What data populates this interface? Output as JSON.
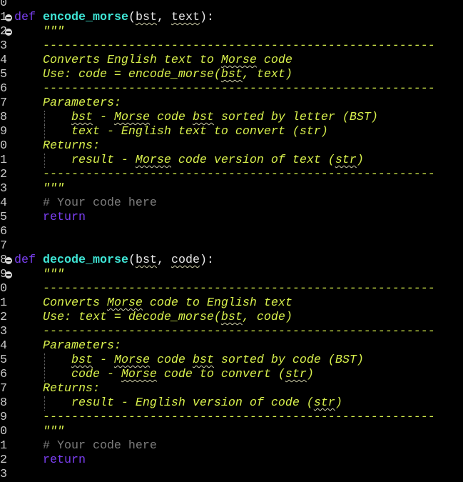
{
  "colors": {
    "keyword": "#7b3ff2",
    "function": "#3fe6d6",
    "docstring": "#d8f04c",
    "comment": "#7c7c7c",
    "background": "#000000"
  },
  "lines": [
    {
      "n": "0",
      "tokens": []
    },
    {
      "n": "1",
      "fold": true,
      "tokens": [
        {
          "t": "def",
          "c": "kw"
        },
        {
          "t": " ",
          "c": "p"
        },
        {
          "t": "encode_morse",
          "c": "fn"
        },
        {
          "t": "(",
          "c": "p"
        },
        {
          "t": "bst",
          "c": "p",
          "u": true
        },
        {
          "t": ", ",
          "c": "p"
        },
        {
          "t": "text",
          "c": "p",
          "u": true
        },
        {
          "t": "):",
          "c": "p"
        }
      ]
    },
    {
      "n": "2",
      "fold": true,
      "tokens": [
        {
          "t": "    \"\"\"",
          "c": "doc"
        }
      ]
    },
    {
      "n": "3",
      "tokens": [
        {
          "t": "    -------------------------------------------------------",
          "c": "doc"
        }
      ]
    },
    {
      "n": "4",
      "tokens": [
        {
          "t": "    Converts English text to ",
          "c": "doc"
        },
        {
          "t": "Morse",
          "c": "doc",
          "u": true
        },
        {
          "t": " code",
          "c": "doc"
        }
      ]
    },
    {
      "n": "5",
      "tokens": [
        {
          "t": "    Use: code = encode_morse(",
          "c": "doc"
        },
        {
          "t": "bst",
          "c": "doc",
          "u": true
        },
        {
          "t": ", text)",
          "c": "doc"
        }
      ]
    },
    {
      "n": "6",
      "tokens": [
        {
          "t": "    -------------------------------------------------------",
          "c": "doc"
        }
      ]
    },
    {
      "n": "7",
      "tokens": [
        {
          "t": "    Parameters:",
          "c": "doc"
        }
      ]
    },
    {
      "n": "8",
      "guide": true,
      "tokens": [
        {
          "t": "        ",
          "c": "doc"
        },
        {
          "t": "bst",
          "c": "doc",
          "u": true
        },
        {
          "t": " - ",
          "c": "doc"
        },
        {
          "t": "Morse",
          "c": "doc",
          "u": true
        },
        {
          "t": " code ",
          "c": "doc"
        },
        {
          "t": "bst",
          "c": "doc",
          "u": true
        },
        {
          "t": " sorted by letter (BST)",
          "c": "doc"
        }
      ]
    },
    {
      "n": "9",
      "guide": true,
      "tokens": [
        {
          "t": "        text - English text to convert (str)",
          "c": "doc"
        }
      ]
    },
    {
      "n": "0",
      "tokens": [
        {
          "t": "    Returns:",
          "c": "doc"
        }
      ]
    },
    {
      "n": "1",
      "guide": true,
      "tokens": [
        {
          "t": "        result - ",
          "c": "doc"
        },
        {
          "t": "Morse",
          "c": "doc",
          "u": true
        },
        {
          "t": " code version of text (",
          "c": "doc"
        },
        {
          "t": "str",
          "c": "doc",
          "u": true
        },
        {
          "t": ")",
          "c": "doc"
        }
      ]
    },
    {
      "n": "2",
      "tokens": [
        {
          "t": "    -------------------------------------------------------",
          "c": "doc"
        }
      ]
    },
    {
      "n": "3",
      "tokens": [
        {
          "t": "    \"\"\"",
          "c": "doc"
        }
      ]
    },
    {
      "n": "4",
      "tokens": [
        {
          "t": "    # Your code here",
          "c": "cm"
        }
      ]
    },
    {
      "n": "5",
      "tokens": [
        {
          "t": "    ",
          "c": "p"
        },
        {
          "t": "return",
          "c": "kw"
        }
      ]
    },
    {
      "n": "6",
      "tokens": []
    },
    {
      "n": "7",
      "tokens": []
    },
    {
      "n": "8",
      "fold": true,
      "tokens": [
        {
          "t": "def",
          "c": "kw"
        },
        {
          "t": " ",
          "c": "p"
        },
        {
          "t": "decode_morse",
          "c": "fn"
        },
        {
          "t": "(",
          "c": "p"
        },
        {
          "t": "bst",
          "c": "p",
          "u": true
        },
        {
          "t": ", ",
          "c": "p"
        },
        {
          "t": "code",
          "c": "p",
          "u": true
        },
        {
          "t": "):",
          "c": "p"
        }
      ]
    },
    {
      "n": "9",
      "fold": true,
      "tokens": [
        {
          "t": "    \"\"\"",
          "c": "doc"
        }
      ]
    },
    {
      "n": "0",
      "tokens": [
        {
          "t": "    -------------------------------------------------------",
          "c": "doc"
        }
      ]
    },
    {
      "n": "1",
      "tokens": [
        {
          "t": "    Converts ",
          "c": "doc"
        },
        {
          "t": "Morse",
          "c": "doc",
          "u": true
        },
        {
          "t": " code to English text",
          "c": "doc"
        }
      ]
    },
    {
      "n": "2",
      "tokens": [
        {
          "t": "    Use: text = decode_morse(",
          "c": "doc"
        },
        {
          "t": "bst",
          "c": "doc",
          "u": true
        },
        {
          "t": ", code)",
          "c": "doc"
        }
      ]
    },
    {
      "n": "3",
      "tokens": [
        {
          "t": "    -------------------------------------------------------",
          "c": "doc"
        }
      ]
    },
    {
      "n": "4",
      "tokens": [
        {
          "t": "    Parameters:",
          "c": "doc"
        }
      ]
    },
    {
      "n": "5",
      "guide": true,
      "tokens": [
        {
          "t": "        ",
          "c": "doc"
        },
        {
          "t": "bst",
          "c": "doc",
          "u": true
        },
        {
          "t": " - ",
          "c": "doc"
        },
        {
          "t": "Morse",
          "c": "doc",
          "u": true
        },
        {
          "t": " code ",
          "c": "doc"
        },
        {
          "t": "bst",
          "c": "doc",
          "u": true
        },
        {
          "t": " sorted by code (BST)",
          "c": "doc"
        }
      ]
    },
    {
      "n": "6",
      "guide": true,
      "tokens": [
        {
          "t": "        code - ",
          "c": "doc"
        },
        {
          "t": "Morse",
          "c": "doc",
          "u": true
        },
        {
          "t": " code to convert (",
          "c": "doc"
        },
        {
          "t": "str",
          "c": "doc",
          "u": true
        },
        {
          "t": ")",
          "c": "doc"
        }
      ]
    },
    {
      "n": "7",
      "tokens": [
        {
          "t": "    Returns:",
          "c": "doc"
        }
      ]
    },
    {
      "n": "8",
      "guide": true,
      "tokens": [
        {
          "t": "        result - English version of code (",
          "c": "doc"
        },
        {
          "t": "str",
          "c": "doc",
          "u": true
        },
        {
          "t": ")",
          "c": "doc"
        }
      ]
    },
    {
      "n": "9",
      "tokens": [
        {
          "t": "    -------------------------------------------------------",
          "c": "doc"
        }
      ]
    },
    {
      "n": "0",
      "tokens": [
        {
          "t": "    \"\"\"",
          "c": "doc"
        }
      ]
    },
    {
      "n": "1",
      "tokens": [
        {
          "t": "    # Your code here",
          "c": "cm"
        }
      ]
    },
    {
      "n": "2",
      "tokens": [
        {
          "t": "    ",
          "c": "p"
        },
        {
          "t": "return",
          "c": "kw"
        }
      ]
    },
    {
      "n": "3",
      "tokens": []
    }
  ]
}
